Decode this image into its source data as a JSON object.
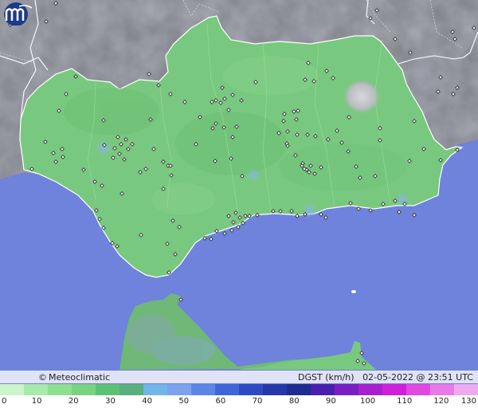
{
  "map": {
    "brand": "Meteoclimatic",
    "brand_symbol": "©",
    "variable_label": "DGST (km/h)",
    "timestamp": "02-05-2022 @ 23:51 UTC",
    "colors": {
      "sea": "#6f82dc",
      "land_outside": "#a9a9b4",
      "andalusia": "#79c87f",
      "africa": "#6fb878",
      "border": "#ffffff"
    }
  },
  "legend": {
    "ticks": [
      "0",
      "10",
      "20",
      "30",
      "40",
      "50",
      "60",
      "70",
      "80",
      "90",
      "100",
      "110",
      "120",
      "130"
    ],
    "colors": [
      "#ccf5cc",
      "#a8eba8",
      "#8ee08e",
      "#78d47f",
      "#5cc273",
      "#5ab07a",
      "#70b6e8",
      "#7ca2ee",
      "#5c86e6",
      "#3e66d8",
      "#2d4cc4",
      "#2538a8",
      "#1c2c8f",
      "#4a1fae",
      "#7a1ec2",
      "#a81fd0",
      "#d01fd8",
      "#e048e0",
      "#e87ae8",
      "#f0aaf0"
    ]
  },
  "stations": [
    [
      13,
      31
    ],
    [
      58,
      27
    ],
    [
      70,
      4
    ],
    [
      465,
      23
    ],
    [
      473,
      13
    ],
    [
      568,
      40
    ],
    [
      571,
      49
    ],
    [
      595,
      35
    ],
    [
      553,
      97
    ],
    [
      574,
      110
    ],
    [
      569,
      118
    ],
    [
      496,
      49
    ],
    [
      515,
      66
    ],
    [
      550,
      115
    ],
    [
      410,
      89
    ],
    [
      418,
      98
    ],
    [
      394,
      102
    ],
    [
      387,
      79
    ],
    [
      383,
      100
    ],
    [
      321,
      103
    ],
    [
      279,
      110
    ],
    [
      282,
      124
    ],
    [
      277,
      129
    ],
    [
      271,
      126
    ],
    [
      266,
      128
    ],
    [
      292,
      119
    ],
    [
      303,
      126
    ],
    [
      287,
      138
    ],
    [
      297,
      159
    ],
    [
      281,
      160
    ],
    [
      292,
      172
    ],
    [
      290,
      199
    ],
    [
      270,
      202
    ],
    [
      251,
      147
    ],
    [
      232,
      128
    ],
    [
      246,
      181
    ],
    [
      199,
      107
    ],
    [
      187,
      93
    ],
    [
      214,
      118
    ],
    [
      95,
      96
    ],
    [
      83,
      118
    ],
    [
      74,
      139
    ],
    [
      57,
      178
    ],
    [
      67,
      192
    ],
    [
      70,
      203
    ],
    [
      78,
      187
    ],
    [
      79,
      197
    ],
    [
      105,
      213
    ],
    [
      119,
      228
    ],
    [
      130,
      151
    ],
    [
      148,
      172
    ],
    [
      152,
      181
    ],
    [
      158,
      175
    ],
    [
      161,
      187
    ],
    [
      166,
      181
    ],
    [
      150,
      193
    ],
    [
      144,
      186
    ],
    [
      142,
      198
    ],
    [
      131,
      182
    ],
    [
      156,
      200
    ],
    [
      193,
      187
    ],
    [
      205,
      203
    ],
    [
      211,
      208
    ],
    [
      215,
      220
    ],
    [
      205,
      237
    ],
    [
      183,
      212
    ],
    [
      176,
      216
    ],
    [
      153,
      243
    ],
    [
      121,
      264
    ],
    [
      125,
      275
    ],
    [
      130,
      286
    ],
    [
      141,
      305
    ],
    [
      147,
      309
    ],
    [
      177,
      295
    ],
    [
      217,
      277
    ],
    [
      225,
      285
    ],
    [
      210,
      306
    ],
    [
      220,
      319
    ],
    [
      212,
      342
    ],
    [
      257,
      299
    ],
    [
      265,
      300
    ],
    [
      272,
      290
    ],
    [
      282,
      293
    ],
    [
      287,
      271
    ],
    [
      296,
      267
    ],
    [
      301,
      273
    ],
    [
      308,
      271
    ],
    [
      293,
      279
    ],
    [
      291,
      289
    ],
    [
      299,
      285
    ],
    [
      305,
      280
    ],
    [
      313,
      271
    ],
    [
      323,
      270
    ],
    [
      343,
      265
    ],
    [
      352,
      265
    ],
    [
      366,
      265
    ],
    [
      373,
      271
    ],
    [
      383,
      269
    ],
    [
      403,
      269
    ],
    [
      409,
      273
    ],
    [
      440,
      255
    ],
    [
      450,
      262
    ],
    [
      465,
      264
    ],
    [
      481,
      256
    ],
    [
      496,
      252
    ],
    [
      508,
      256
    ],
    [
      501,
      266
    ],
    [
      520,
      270
    ],
    [
      532,
      187
    ],
    [
      553,
      201
    ],
    [
      574,
      188
    ],
    [
      514,
      202
    ],
    [
      520,
      152
    ],
    [
      477,
      161
    ],
    [
      477,
      176
    ],
    [
      438,
      147
    ],
    [
      423,
      164
    ],
    [
      429,
      179
    ],
    [
      437,
      190
    ],
    [
      412,
      175
    ],
    [
      396,
      171
    ],
    [
      386,
      169
    ],
    [
      373,
      169
    ],
    [
      372,
      150
    ],
    [
      357,
      143
    ],
    [
      356,
      152
    ],
    [
      361,
      165
    ],
    [
      350,
      167
    ],
    [
      369,
      140
    ],
    [
      374,
      139
    ],
    [
      361,
      183
    ],
    [
      371,
      195
    ],
    [
      380,
      205
    ],
    [
      385,
      213
    ],
    [
      390,
      208
    ],
    [
      403,
      210
    ],
    [
      395,
      218
    ],
    [
      382,
      212
    ],
    [
      360,
      180
    ],
    [
      379,
      208
    ],
    [
      388,
      216
    ],
    [
      267,
      161
    ],
    [
      271,
      155
    ],
    [
      214,
      208
    ],
    [
      189,
      150
    ],
    [
      128,
      233
    ],
    [
      40,
      212
    ],
    [
      304,
      221
    ],
    [
      447,
      209
    ],
    [
      452,
      223
    ],
    [
      471,
      221
    ],
    [
      227,
      376
    ],
    [
      454,
      443
    ],
    [
      449,
      453
    ],
    [
      457,
      456
    ]
  ]
}
